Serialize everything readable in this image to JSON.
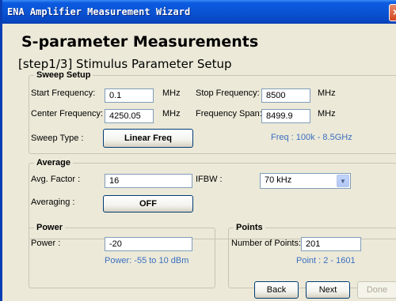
{
  "window": {
    "title": "ENA Amplifier Measurement Wizard",
    "close_icon": "×"
  },
  "header": {
    "title": "S-parameter Measurements",
    "step": "[step1/3] Stimulus Parameter Setup"
  },
  "sweep_setup": {
    "legend": "Sweep Setup",
    "start_frequency": {
      "label": "Start Frequency:",
      "value": "0.1",
      "unit": "MHz"
    },
    "stop_frequency": {
      "label": "Stop Frequency:",
      "value": "8500",
      "unit": "MHz"
    },
    "center_frequency": {
      "label": "Center Frequency:",
      "value": "4250.05",
      "unit": "MHz"
    },
    "frequency_span": {
      "label": "Frequency Span:",
      "value": "8499.9",
      "unit": "MHz"
    },
    "sweep_type": {
      "label": "Sweep Type :",
      "button": "Linear Freq"
    },
    "freq_hint": "Freq : 100k - 8.5GHz"
  },
  "average": {
    "legend": "Average",
    "avg_factor": {
      "label": "Avg. Factor :",
      "value": "16"
    },
    "ifbw": {
      "label": "IFBW :",
      "selected": "70 kHz"
    },
    "averaging": {
      "label": "Averaging :",
      "button": "OFF"
    }
  },
  "power": {
    "legend": "Power",
    "label": "Power :",
    "value": "-20",
    "hint": "Power: -55 to 10 dBm"
  },
  "points": {
    "legend": "Points",
    "label": "Number of Points:",
    "value": "201",
    "hint": "Point : 2 - 1601"
  },
  "footer": {
    "back": "Back",
    "next": "Next",
    "done": "Done"
  }
}
